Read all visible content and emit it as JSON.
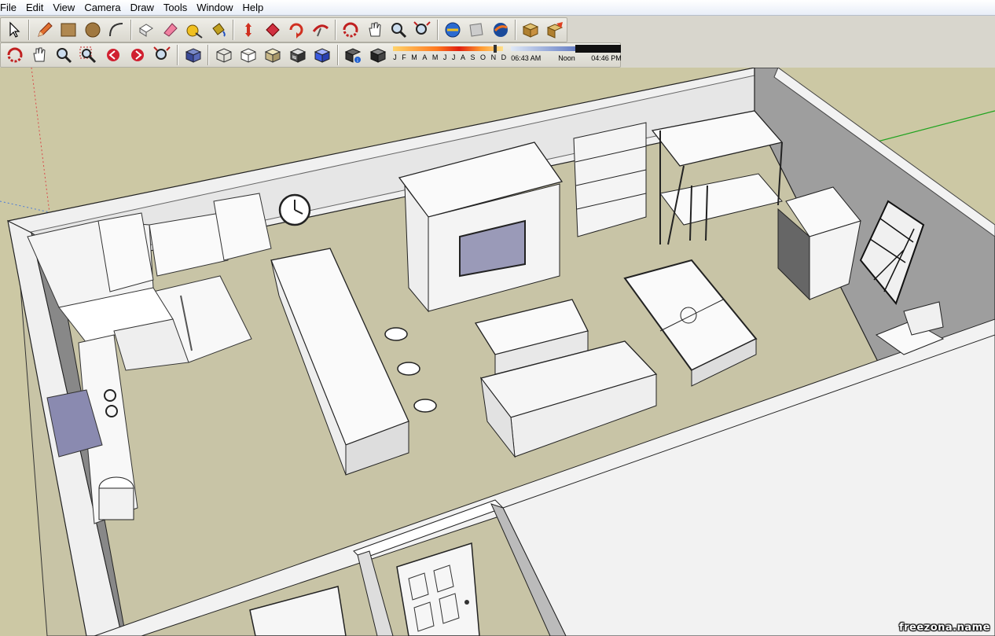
{
  "menu": {
    "file": "File",
    "edit": "Edit",
    "view": "View",
    "camera": "Camera",
    "draw": "Draw",
    "tools": "Tools",
    "window": "Window",
    "help": "Help"
  },
  "toolbar_row1": [
    "select-icon",
    "pencil-icon",
    "rectangle-icon",
    "circle-icon",
    "arc-icon",
    "push-pull-icon",
    "eraser-icon",
    "tape-measure-icon",
    "paint-bucket-icon",
    "move-icon",
    "rotate-icon",
    "offset-icon",
    "follow-me-icon",
    "orbit-icon",
    "pan-icon",
    "zoom-icon",
    "zoom-extents-icon",
    "get-models-icon",
    "share-model-icon",
    "google-earth-icon",
    "components-icon",
    "warehouse-icon"
  ],
  "toolbar_row2": [
    "orbit-icon",
    "pan-icon",
    "zoom-icon",
    "zoom-window-icon",
    "previous-view-icon",
    "next-view-icon",
    "zoom-extents-icon",
    "iso-view-icon",
    "xray-icon",
    "wireframe-icon",
    "hidden-line-icon",
    "shaded-icon",
    "textured-icon",
    "monochrome-icon",
    "shadow-settings-icon",
    "shadow-toggle-icon"
  ],
  "shadows": {
    "months": [
      "J",
      "F",
      "M",
      "A",
      "M",
      "J",
      "J",
      "A",
      "S",
      "O",
      "N",
      "D"
    ],
    "start_time": "06:43 AM",
    "noon": "Noon",
    "end_time": "04:46 PM"
  },
  "colors": {
    "ground": "#ccc8a4",
    "floor": "#c6c2a3",
    "sky_axis_green": "#1fa31f",
    "axis_red": "#d84a4a",
    "wall_light": "#f2f2f2",
    "wall_dark": "#9e9e9e"
  },
  "watermark": "freezona.name"
}
